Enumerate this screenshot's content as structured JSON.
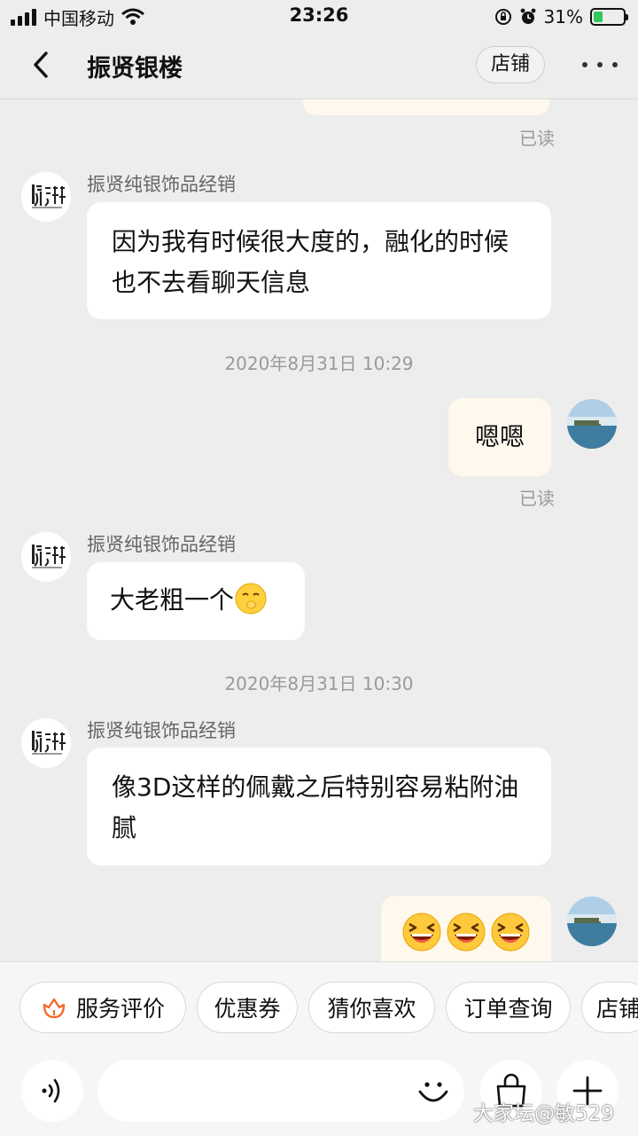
{
  "status_bar": {
    "carrier": "中国移动",
    "time": "23:26",
    "battery": "31%",
    "battery_level": 0.31
  },
  "header": {
    "title": "振贤银楼",
    "shop_button": "店铺"
  },
  "chat": {
    "read_label": "已读",
    "sender_name": "振贤纯银饰品经销",
    "msg1": "因为我有时候很大度的，融化的时候也不去看聊天信息",
    "time1": "2020年8月31日 10:29",
    "my_msg1": "嗯嗯",
    "msg2": "大老粗一个",
    "time2": "2020年8月31日 10:30",
    "msg3": "像3D这样的佩戴之后特别容易粘附油腻"
  },
  "quick_actions": [
    "服务评价",
    "优惠券",
    "猜你喜欢",
    "订单查询",
    "店铺"
  ],
  "watermark": "大家坛@敏529",
  "colors": {
    "background": "#ededed",
    "my_bubble": "#fff8ec",
    "accent_orange": "#f26b2a",
    "battery_green": "#32c75a"
  }
}
